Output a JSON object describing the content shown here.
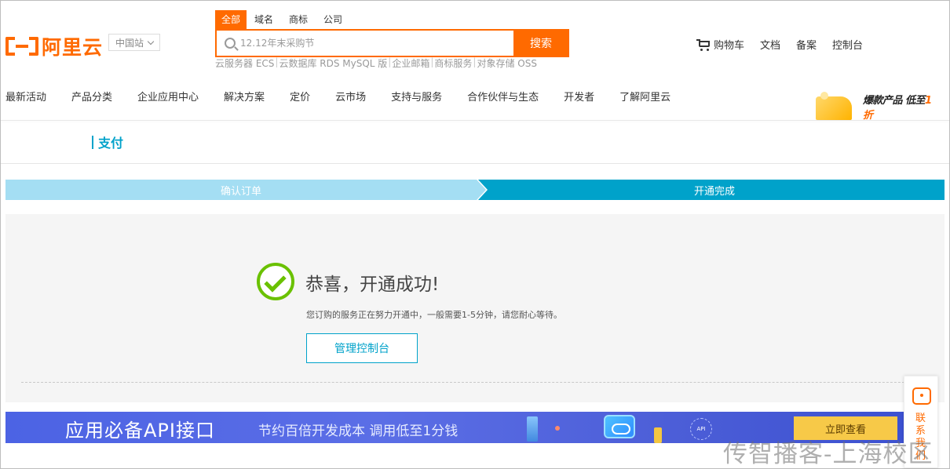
{
  "header": {
    "logo_text": "阿里云",
    "site_select": "中国站",
    "search_tabs": [
      "全部",
      "域名",
      "商标",
      "公司"
    ],
    "search_placeholder": "12.12年末采购节",
    "search_button": "搜索",
    "hotwords": [
      "云服务器 ECS",
      "云数据库 RDS MySQL 版",
      "企业邮箱",
      "商标服务",
      "对象存储 OSS"
    ],
    "top_links": {
      "cart": "购物车",
      "docs": "文档",
      "filing": "备案",
      "console": "控制台"
    }
  },
  "nav": {
    "items": [
      "最新活动",
      "产品分类",
      "企业应用中心",
      "解决方案",
      "定价",
      "云市场",
      "支持与服务",
      "合作伙伴与生态",
      "开发者",
      "了解阿里云"
    ],
    "promo_text_a": "爆款产品 低至",
    "promo_text_b": "1折"
  },
  "page": {
    "title": "支付"
  },
  "steps": {
    "step1": "确认订单",
    "step2": "开通完成"
  },
  "success": {
    "title": "恭喜，开通成功!",
    "desc": "您订购的服务正在努力开通中，一般需要1-5分钟，请您耐心等待。",
    "console_button": "管理控制台"
  },
  "api_banner": {
    "main": "应用必备API接口",
    "sub": "节约百倍开发成本 调用低至1分钱",
    "badge": "API",
    "cta": "立即查看"
  },
  "contact": {
    "label": "联系我们"
  },
  "watermark": "传智播客-上海校区",
  "colors": {
    "brand": "#ff6a00",
    "accent": "#00a2ca",
    "step_inactive": "#a4def3",
    "success": "#6ac100"
  }
}
